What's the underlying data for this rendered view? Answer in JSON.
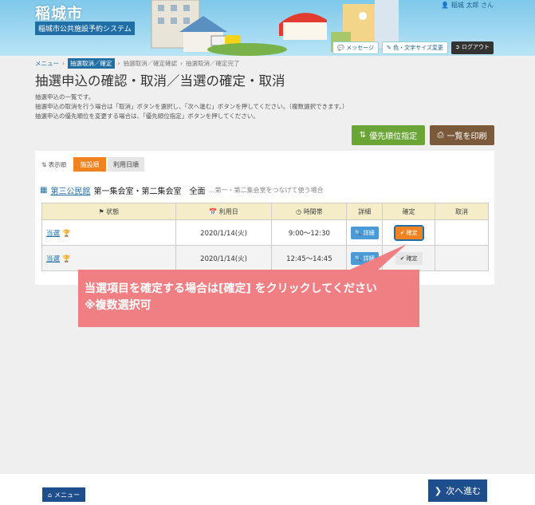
{
  "header": {
    "city_name": "稲城市",
    "system_name": "稲城市公共施設予約システム",
    "user_label": "稲城 太郎 さん",
    "message_label": "メッセージ",
    "font_size_label": "色・文字サイズ変更",
    "logout_label": "ログアウト"
  },
  "breadcrumb": {
    "menu": "メニュー",
    "current": "抽選取消／確定",
    "step2": "抽選取消／確定確認",
    "step3": "抽選取消／確定完了"
  },
  "page": {
    "title": "抽選申込の確認・取消／当選の確定・取消",
    "desc1": "抽選申込の一覧です。",
    "desc2": "抽選申込の取消を行う場合は「取消」ボタンを選択し、「次へ進む」ボタンを押してください。（複数選択できます。）",
    "desc3": "抽選申込の優先順位を変更する場合は、「優先順位指定」ボタンを押してください。",
    "priority_button": "優先順位指定",
    "print_button": "一覧を印刷"
  },
  "sort": {
    "label": "表示順",
    "by_facility": "施設順",
    "by_date": "利用日順"
  },
  "facility": {
    "name": "第三公民館",
    "rooms": "第一集会室・第二集会室　全面",
    "note": "…第一・第二集会室をつなげて使う場合"
  },
  "table": {
    "headers": {
      "status": "状態",
      "date": "利用日",
      "time": "時間帯",
      "detail": "詳細",
      "confirm": "確定",
      "cancel": "取消"
    },
    "detail_label": "詳細",
    "confirm_label": "確定",
    "rows": [
      {
        "status": "当選",
        "date": "2020/1/14(火)",
        "time": "9:00～12:30"
      },
      {
        "status": "当選",
        "date": "2020/1/14(火)",
        "time": "12:45～14:45"
      }
    ]
  },
  "callout": {
    "line1": "当選項目を確定する場合は[確定] をクリックしてください",
    "line2": "※複数選択可"
  },
  "footer": {
    "menu_button": "メニュー",
    "next_button": "次へ進む"
  },
  "colors": {
    "accent_blue": "#1f4e8c",
    "orange": "#f0831f",
    "green": "#6ba437",
    "brown": "#7b5a3c",
    "callout": "#f07f83"
  }
}
